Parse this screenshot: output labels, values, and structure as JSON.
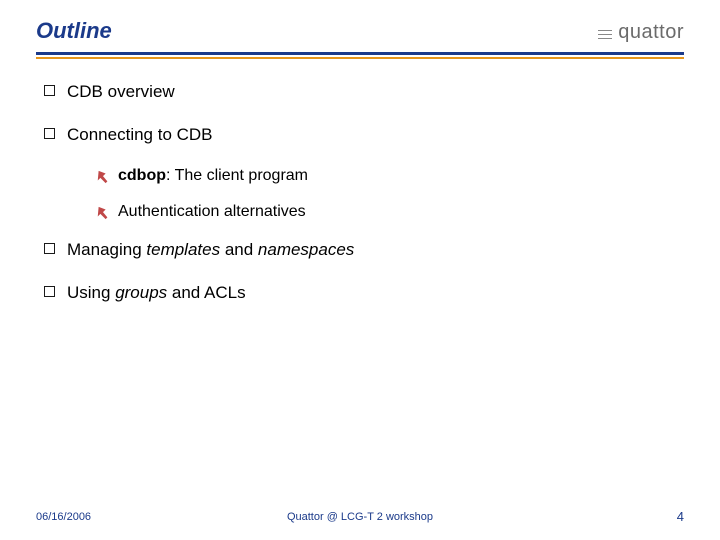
{
  "header": {
    "title": "Outline",
    "brand": "quattor"
  },
  "bullets": [
    {
      "html": "CDB overview"
    },
    {
      "html": "Connecting to CDB",
      "children": [
        {
          "html": "<b class='run'>cdbop</b>: The client program"
        },
        {
          "html": "Authentication alternatives"
        }
      ]
    },
    {
      "html": "Managing <em class='run'>templates</em> and <em class='run'>namespaces</em>"
    },
    {
      "html": "Using <em class='run'>groups</em> and ACLs"
    }
  ],
  "footer": {
    "date": "06/16/2006",
    "center": "Quattor @ LCG-T 2 workshop",
    "page": "4"
  }
}
